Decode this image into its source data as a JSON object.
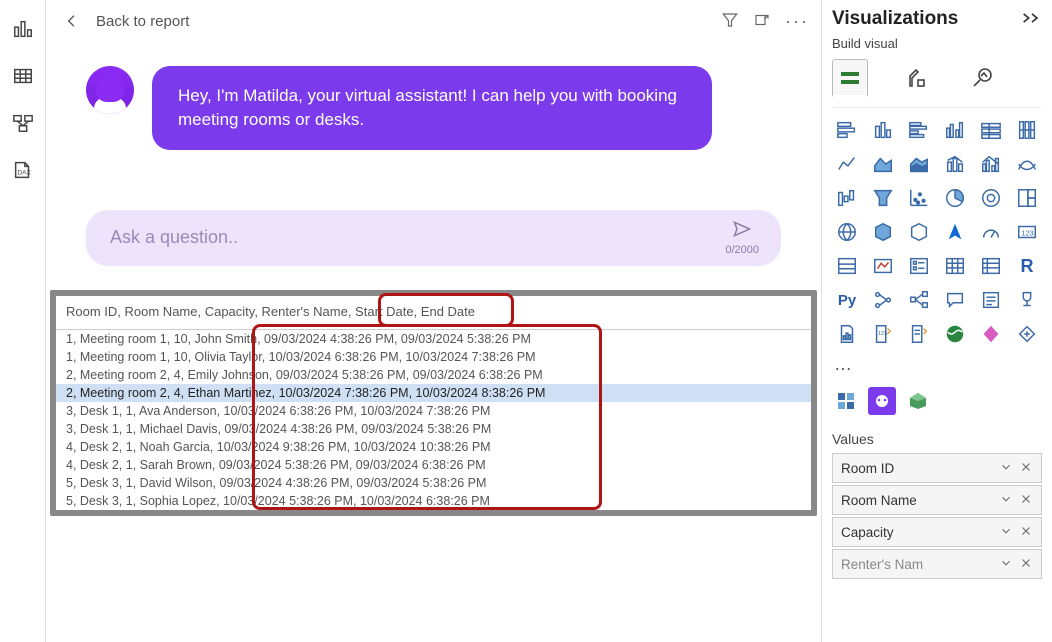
{
  "leftRail": {
    "icons": [
      "bar-chart-icon",
      "table-icon",
      "model-icon",
      "dax-icon"
    ]
  },
  "top": {
    "back": "Back to report"
  },
  "chat": {
    "bubble": "Hey, I'm Matilda, your virtual assistant! I can help you with booking meeting rooms or desks.",
    "placeholder": "Ask a question..",
    "counter": "0/2000"
  },
  "visual": {
    "header": "Room ID, Room Name, Capacity, Renter's Name, Start Date, End Date",
    "rows": [
      "1, Meeting room 1, 10, John Smith, 09/03/2024 4:38:26 PM, 09/03/2024 5:38:26 PM",
      "1, Meeting room 1, 10, Olivia Taylor, 10/03/2024 6:38:26 PM, 10/03/2024 7:38:26 PM",
      "2, Meeting room 2, 4, Emily Johnson, 09/03/2024 5:38:26 PM, 09/03/2024 6:38:26 PM",
      "2, Meeting room 2, 4, Ethan Martinez, 10/03/2024 7:38:26 PM, 10/03/2024 8:38:26 PM",
      "3, Desk 1, 1, Ava Anderson, 10/03/2024 6:38:26 PM, 10/03/2024 7:38:26 PM",
      "3, Desk 1, 1, Michael Davis, 09/03/2024 4:38:26 PM, 09/03/2024 5:38:26 PM",
      "4, Desk 2, 1, Noah Garcia, 10/03/2024 9:38:26 PM, 10/03/2024 10:38:26 PM",
      "4, Desk 2, 1, Sarah Brown, 09/03/2024 5:38:26 PM, 09/03/2024 6:38:26 PM",
      "5, Desk 3, 1, David Wilson, 09/03/2024 4:38:26 PM, 09/03/2024 5:38:26 PM",
      "5, Desk 3, 1, Sophia Lopez, 10/03/2024 5:38:26 PM, 10/03/2024 6:38:26 PM"
    ],
    "selected_index": 3
  },
  "right": {
    "title": "Visualizations",
    "subhead": "Build visual",
    "ellipsis": "…",
    "values_label": "Values",
    "fields": [
      "Room ID",
      "Room Name",
      "Capacity",
      "Renter's Name"
    ]
  }
}
